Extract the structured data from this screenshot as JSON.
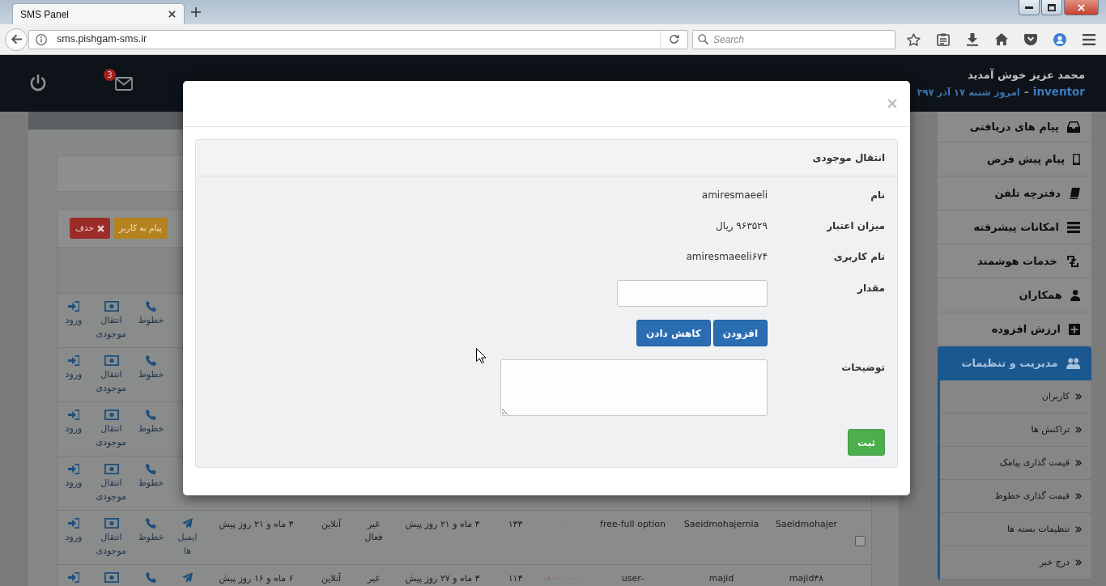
{
  "browser": {
    "tab_title": "SMS Panel",
    "url": "sms.pishgam-sms.ir",
    "search": {
      "placeholder": "Search"
    }
  },
  "header": {
    "mail_badge": "3",
    "welcome": "محمد عزیز خوش آمدید",
    "username": "inventor",
    "separator": "–",
    "date": "امروز شنبه ۱۷ آذر ۳۹۷"
  },
  "sidebar": {
    "items": [
      {
        "label": "پیام های دریافتی",
        "selected": false
      },
      {
        "label": "پیام پیش فرض",
        "selected": false
      },
      {
        "label": "دفترچه تلفن",
        "selected": false
      },
      {
        "label": "امکانات پیشرفته",
        "selected": false
      },
      {
        "label": "خدمات هوشمند",
        "selected": false
      },
      {
        "label": "همکاران",
        "selected": false
      },
      {
        "label": "ارزش افزوده",
        "selected": false
      },
      {
        "label": "مدیریت و تنظیمات",
        "selected": true,
        "children": [
          {
            "label": "کاربران",
            "selected": false
          },
          {
            "label": "تراکنش ها",
            "selected": false
          },
          {
            "label": "قیمت گذاری پیامک",
            "selected": false
          },
          {
            "label": "قیمت گذاری خطوط",
            "selected": false
          },
          {
            "label": "تنظیمات بسته ها",
            "selected": false
          },
          {
            "label": "درج خبر",
            "selected": false
          }
        ]
      }
    ]
  },
  "users_panel": {
    "buttons": [
      {
        "kind": "warning",
        "label": "پیام به کاربر"
      },
      {
        "kind": "danger",
        "label": "حذف"
      }
    ],
    "table": {
      "rows": [
        {
          "actions": [
            {
              "kind": "lines",
              "label": "خطوط"
            },
            {
              "kind": "transfer",
              "label": "انتقال موجودی"
            },
            {
              "kind": "login",
              "label": "ورود"
            }
          ]
        },
        {
          "actions": [
            {
              "kind": "lines",
              "label": "خطوط"
            },
            {
              "kind": "transfer",
              "label": "انتقال موجودی"
            },
            {
              "kind": "login",
              "label": "ورود"
            }
          ]
        },
        {
          "actions": [
            {
              "kind": "lines",
              "label": "خطوط"
            },
            {
              "kind": "transfer",
              "label": "انتقال موجودی"
            },
            {
              "kind": "login",
              "label": "ورود"
            }
          ]
        },
        {
          "actions": [
            {
              "kind": "lines",
              "label": "خطوط"
            },
            {
              "kind": "transfer",
              "label": "انتقال موجودی"
            },
            {
              "kind": "login",
              "label": "ورود"
            }
          ]
        },
        {
          "checked": false,
          "cells": [
            "Saeidmohajer",
            "Saeidmohajernia",
            "free-full option",
            "۰",
            "۱۳۳",
            "۳ ماه و ۲۱ روز پیش",
            "غیر فعال",
            "آنلاین",
            "۳ ماه و ۲۱ روز پیش"
          ],
          "actions": [
            {
              "kind": "email",
              "label": "ایمیل ها"
            },
            {
              "kind": "lines",
              "label": "خطوط"
            },
            {
              "kind": "transfer",
              "label": "انتقال موجودی"
            },
            {
              "kind": "login",
              "label": "ورود"
            }
          ]
        },
        {
          "cells": [
            "majid۳۸",
            "majid",
            "user-",
            "-۱۰۰۰۰۰۰",
            "۱۱۳",
            "۳ ماه و ۲۷ روز پیش",
            "غیر",
            "آنلاین",
            "۶ ماه و ۱۶ روز پیش"
          ],
          "actions": [
            {
              "kind": "email"
            },
            {
              "kind": "lines"
            },
            {
              "kind": "transfer"
            },
            {
              "kind": "login"
            }
          ]
        }
      ]
    }
  },
  "modal": {
    "title": "انتقال موجودی",
    "fields": [
      {
        "kind": "text",
        "label": "نام",
        "value": "amiresmaeeli"
      },
      {
        "kind": "text",
        "label": "میزان اعتبار",
        "value": "۹۶۳۵۲۹ ریال"
      },
      {
        "kind": "text",
        "label": "نام کاربری",
        "value": "amiresmaeeli۶۷۴"
      },
      {
        "kind": "input",
        "label": "مقدار"
      },
      {
        "kind": "buttons",
        "buttons": [
          {
            "label": "افزودن"
          },
          {
            "label": "کاهش دادن"
          }
        ]
      },
      {
        "kind": "textarea",
        "label": "توضیحات"
      }
    ],
    "submit": "ثبت"
  }
}
